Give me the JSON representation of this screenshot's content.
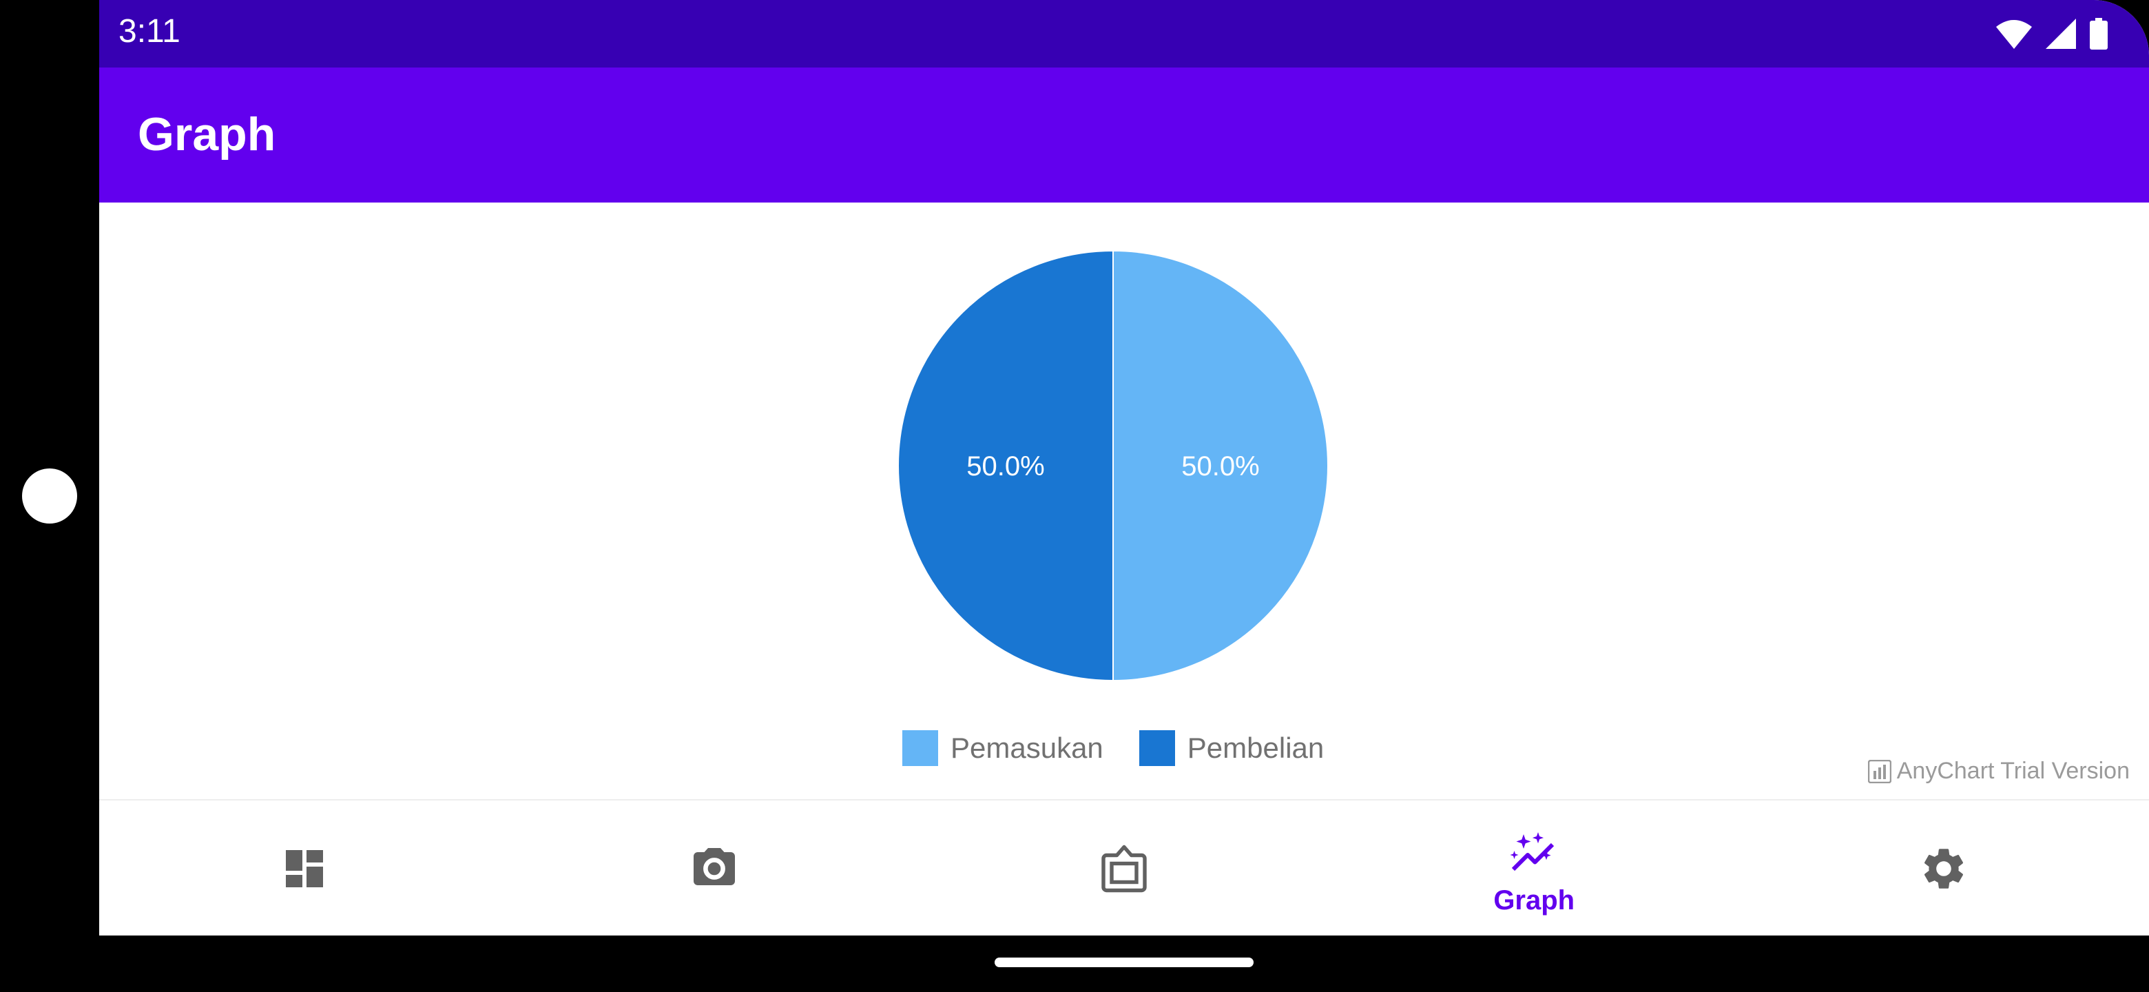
{
  "status_bar": {
    "time": "3:11",
    "icons": [
      "wifi-icon",
      "signal-icon",
      "battery-icon"
    ]
  },
  "app_bar": {
    "title": "Graph"
  },
  "chart_data": {
    "type": "pie",
    "slices": [
      {
        "label": "Pemasukan",
        "value": 50.0,
        "display": "50.0%",
        "color": "#64B5F6"
      },
      {
        "label": "Pembelian",
        "value": 50.0,
        "display": "50.0%",
        "color": "#1976D2"
      }
    ],
    "legend": [
      "Pemasukan",
      "Pembelian"
    ],
    "legend_position": "bottom"
  },
  "watermark": {
    "text": "AnyChart Trial Version"
  },
  "bottom_nav": {
    "items": [
      {
        "icon": "dashboard-icon",
        "label": ""
      },
      {
        "icon": "camera-icon",
        "label": ""
      },
      {
        "icon": "frame-icon",
        "label": ""
      },
      {
        "icon": "graph-sparkle-icon",
        "label": "Graph",
        "selected": true
      },
      {
        "icon": "gear-icon",
        "label": ""
      }
    ],
    "colors": {
      "active": "#6200EE",
      "inactive": "#616161"
    }
  },
  "colors": {
    "status_bar": "#3700B3",
    "app_bar": "#6200EE"
  }
}
